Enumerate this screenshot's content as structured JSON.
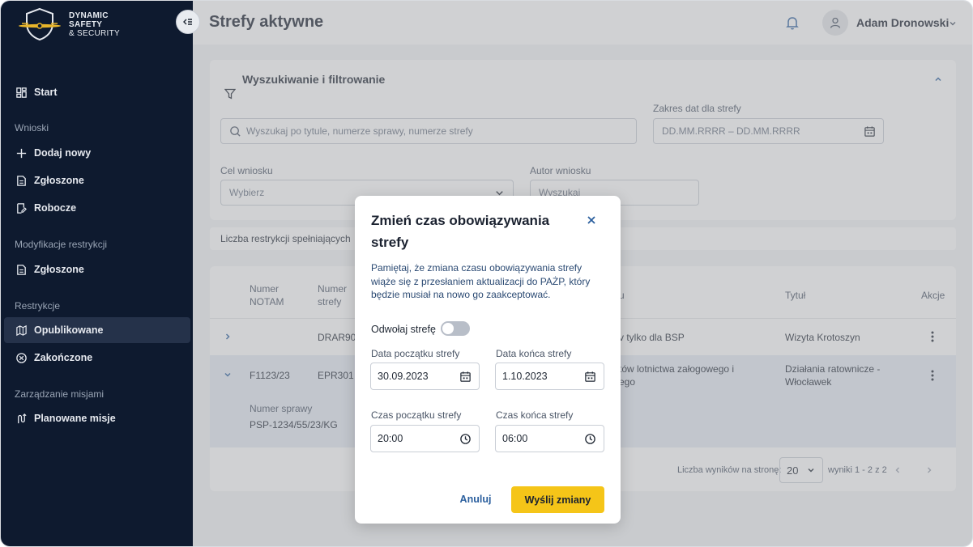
{
  "brand": {
    "line1": "DYNAMIC",
    "line2": "SAFETY",
    "line3": "& SECURITY"
  },
  "sidebar": {
    "start": "Start",
    "sections": {
      "wnioski": "Wnioski",
      "modyfikacje": "Modyfikacje restrykcji",
      "restrykcje": "Restrykcje",
      "misje": "Zarządzanie misjami"
    },
    "items": {
      "dodaj_nowy": "Dodaj nowy",
      "zgloszone": "Zgłoszone",
      "robocze": "Robocze",
      "mod_zgloszone": "Zgłoszone",
      "opublikowane": "Opublikowane",
      "zakonczone": "Zakończone",
      "planowane_misje": "Planowane misje"
    }
  },
  "header": {
    "title": "Strefy aktywne",
    "user_name": "Adam Dronowski"
  },
  "filters": {
    "title": "Wyszukiwanie i filtrowanie",
    "search_placeholder": "Wyszukaj po tytule, numerze sprawy, numerze strefy",
    "date_range_label": "Zakres dat dla strefy",
    "date_range_placeholder": "DD.MM.RRRR – DD.MM.RRRR",
    "purpose_label": "Cel wniosku",
    "purpose_value": "Wybierz",
    "author_label": "Autor wniosku",
    "author_placeholder": "Wyszukaj"
  },
  "results_count_text": "Liczba restrykcji spełniających",
  "table": {
    "headers": {
      "notam_1": "Numer",
      "notam_2": "NOTAM",
      "zone_1": "Numer",
      "zone_2": "strefy",
      "purpose": "u",
      "title": "Tytuł",
      "actions": "Akcje"
    },
    "rows": [
      {
        "notam": "",
        "zone": "DRAR90",
        "purpose": "v tylko dla BSP",
        "title": "Wizyta Krotoszyn"
      },
      {
        "notam": "F1123/23",
        "zone": "EPR301",
        "purpose_1": "tów lotnictwa załogowego i",
        "purpose_2": "ego",
        "title_1": "Działania ratownicze -",
        "title_2": "Włocławek",
        "case_label": "Numer sprawy",
        "case_number": "PSP-1234/55/23/KG"
      }
    ],
    "pager": {
      "label": "Liczba wyników na stronę:",
      "per_page": "20",
      "range": "wyniki 1 - 2 z 2"
    }
  },
  "modal": {
    "title": "Zmień czas obowiązywania strefy",
    "description": "Pamiętaj, że zmiana czasu obowiązywania strefy wiąże się z przesłaniem aktualizacji do PAŻP, który będzie musiał na nowo go zaakceptować.",
    "toggle_label": "Odwołaj strefę",
    "toggle_on": false,
    "start_date_label": "Data początku strefy",
    "start_date": "30.09.2023",
    "end_date_label": "Data końca strefy",
    "end_date": "1.10.2023",
    "start_time_label": "Czas początku strefy",
    "start_time": "20:00",
    "end_time_label": "Czas końca strefy",
    "end_time": "06:00",
    "cancel": "Anuluj",
    "submit": "Wyślij zmiany"
  },
  "colors": {
    "sidebar_bg": "#0e1a2f",
    "accent_yellow": "#f5c518",
    "link_blue": "#2b5f9e"
  }
}
